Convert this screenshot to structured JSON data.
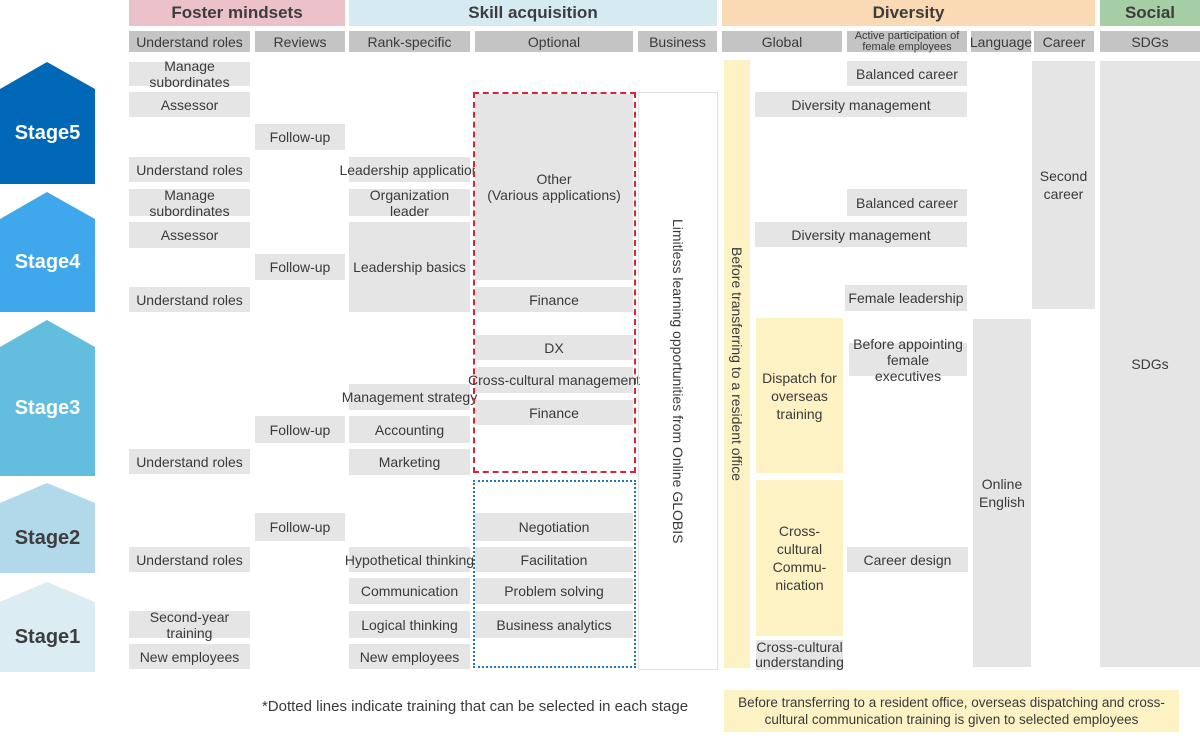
{
  "categories": {
    "foster": {
      "label": "Foster mindsets",
      "color": "#ecc1c9"
    },
    "skill": {
      "label": "Skill acquisition",
      "color": "#d6eaf2"
    },
    "diversity": {
      "label": "Diversity",
      "color": "#fad9b5"
    },
    "social": {
      "label": "Social",
      "color": "#a5cea5"
    }
  },
  "subheaders": [
    "Understand roles",
    "Reviews",
    "Rank-specific",
    "Optional",
    "Business",
    "Global",
    "Active participation of female employees",
    "Language",
    "Career",
    "SDGs"
  ],
  "stages": [
    {
      "label": "Stage5",
      "color": "#0068b7"
    },
    {
      "label": "Stage4",
      "color": "#3fa8ed"
    },
    {
      "label": "Stage3",
      "color": "#62bedc"
    },
    {
      "label": "Stage2",
      "color": "#b1d9ea"
    },
    {
      "label": "Stage1",
      "color": "#dcecf3"
    }
  ],
  "understand_roles": [
    "Manage subordinates",
    "Assessor",
    "Understand roles",
    "Manage subordinates",
    "Assessor",
    "Understand roles",
    "Understand roles",
    "Understand roles",
    "Second-year training",
    "New employees"
  ],
  "reviews": [
    "Follow-up",
    "Follow-up",
    "Follow-up",
    "Follow-up"
  ],
  "rank_specific": [
    "Leadership application",
    "Organization leader",
    "Leadership basics",
    "Management strategy",
    "Accounting",
    "Marketing",
    "Hypothetical thinking",
    "Communication",
    "Logical thinking",
    "New employees"
  ],
  "optional": {
    "other": "Other\n(Various applications)",
    "items": [
      "Finance",
      "DX",
      "Cross-cultural management",
      "Finance",
      "Negotiation",
      "Facilitation",
      "Problem solving",
      "Business analytics"
    ]
  },
  "business": "Limitless learning opportunities from Online GLOBIS",
  "global": {
    "vertical": "Before transferring to a resident office",
    "dispatch": "Dispatch for overseas training",
    "cross_comm": "Cross-cultural Commu-nication",
    "cross_understanding": "Cross-cultural understanding"
  },
  "diversity_mgmt": [
    "Diversity management",
    "Diversity management"
  ],
  "female": [
    "Balanced career",
    "Balanced career",
    "Female leadership",
    "Before appointing female executives",
    "Career design"
  ],
  "language": "Online English",
  "career": "Second career",
  "sdgs": "SDGs",
  "notes": {
    "dotted": "*Dotted lines indicate training that can be selected in each stage",
    "overseas": "Before transferring to a resident office, overseas dispatching and cross-cultural communication training is given to selected employees"
  },
  "colors": {
    "red_dash": "#d6263b",
    "blue_dot": "#1f78c1"
  }
}
